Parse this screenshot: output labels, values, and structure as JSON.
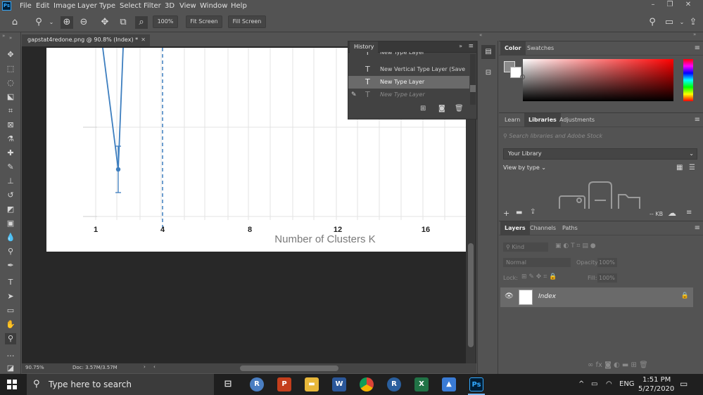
{
  "app": {
    "logo": "Ps",
    "menu": [
      "File",
      "Edit",
      "Image",
      "Layer",
      "Type",
      "Select",
      "Filter",
      "3D",
      "View",
      "Window",
      "Help"
    ]
  },
  "options_bar": {
    "zoom_value": "100%",
    "fit_screen": "Fit Screen",
    "fill_screen": "Fill Screen"
  },
  "document": {
    "tab_title": "gapstat4redone.png @ 90.8% (Index) *",
    "x_axis_title": "Number of Clusters K",
    "tick_labels": [
      "1",
      "4",
      "8",
      "12",
      "16"
    ]
  },
  "chart_data": {
    "type": "line",
    "xlabel": "Number of Clusters K",
    "x_ticks": [
      "1",
      "4",
      "8",
      "12",
      "16"
    ]
  },
  "history": {
    "tab": "History",
    "items": [
      {
        "label": "New Type Layer",
        "state": "normal"
      },
      {
        "label": "New Vertical Type Layer (Save ...",
        "state": "normal"
      },
      {
        "label": "New Type Layer",
        "state": "selected"
      },
      {
        "label": "New Type Layer",
        "state": "disabled"
      }
    ]
  },
  "color_panel": {
    "tabs": [
      "Color",
      "Swatches"
    ]
  },
  "libraries_panel": {
    "tabs": [
      "Learn",
      "Libraries",
      "Adjustments"
    ],
    "search_placeholder": "Search libraries and Adobe Stock",
    "library_select": "Your Library",
    "view_by": "View by type",
    "size": "-- KB"
  },
  "layers_panel": {
    "tabs": [
      "Layers",
      "Channels",
      "Paths"
    ],
    "filter_kind": "Kind",
    "blend_mode": "Normal",
    "opacity_label": "Opacity:",
    "opacity_value": "100%",
    "lock_label": "Lock:",
    "fill_label": "Fill:",
    "fill_value": "100%",
    "layer_name": "Index"
  },
  "status": {
    "zoom": "90.75%",
    "doc": "Doc: 3.57M/3.57M"
  },
  "taskbar": {
    "search_placeholder": "Type here to search",
    "lang": "ENG",
    "time": "1:51 PM",
    "date": "5/27/2020"
  },
  "colors": {
    "app_bg": "#535353",
    "panel_bg": "#424242",
    "chart_line": "#3d7ebf",
    "accent": "#31a8ff"
  }
}
